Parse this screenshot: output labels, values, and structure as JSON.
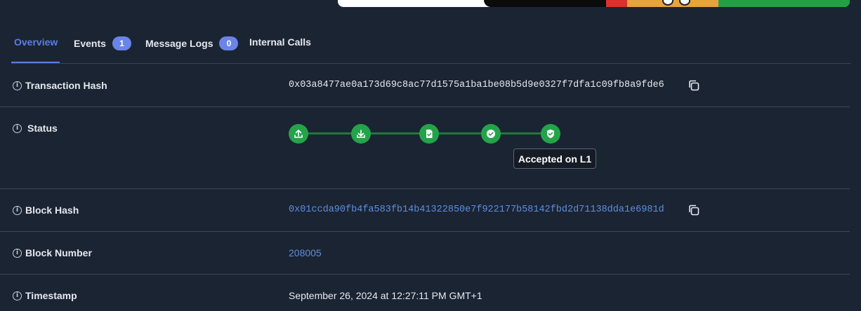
{
  "tabs": [
    {
      "label": "Overview",
      "badge": ""
    },
    {
      "label": "Events",
      "badge": "1"
    },
    {
      "label": "Message Logs",
      "badge": "0"
    },
    {
      "label": "Internal Calls",
      "badge": ""
    }
  ],
  "rows": {
    "tx_hash": {
      "label": "Transaction Hash",
      "value": "0x03a8477ae0a173d69c8ac77d1575a1ba1be08b5d9e0327f7dfa1c09fb8a9fde6"
    },
    "status": {
      "label": "Status",
      "tooltip": "Accepted on L1",
      "steps": [
        "upload-icon",
        "download-icon",
        "document-check-icon",
        "check-circle-icon",
        "shield-check-icon"
      ]
    },
    "block_hash": {
      "label": "Block Hash",
      "value": "0x01ccda90fb4fa583fb14b41322850e7f922177b58142fbd2d71138dda1e6981d"
    },
    "block_number": {
      "label": "Block Number",
      "value": "208005"
    },
    "timestamp": {
      "label": "Timestamp",
      "value": "September 26, 2024 at 12:27:11 PM GMT+1"
    }
  },
  "info_glyph": "i",
  "colors": {
    "background": "#1b2433",
    "accent": "#5b7de8",
    "link": "#5b8fe0",
    "success": "#25a34a",
    "divider": "#3a4556"
  }
}
